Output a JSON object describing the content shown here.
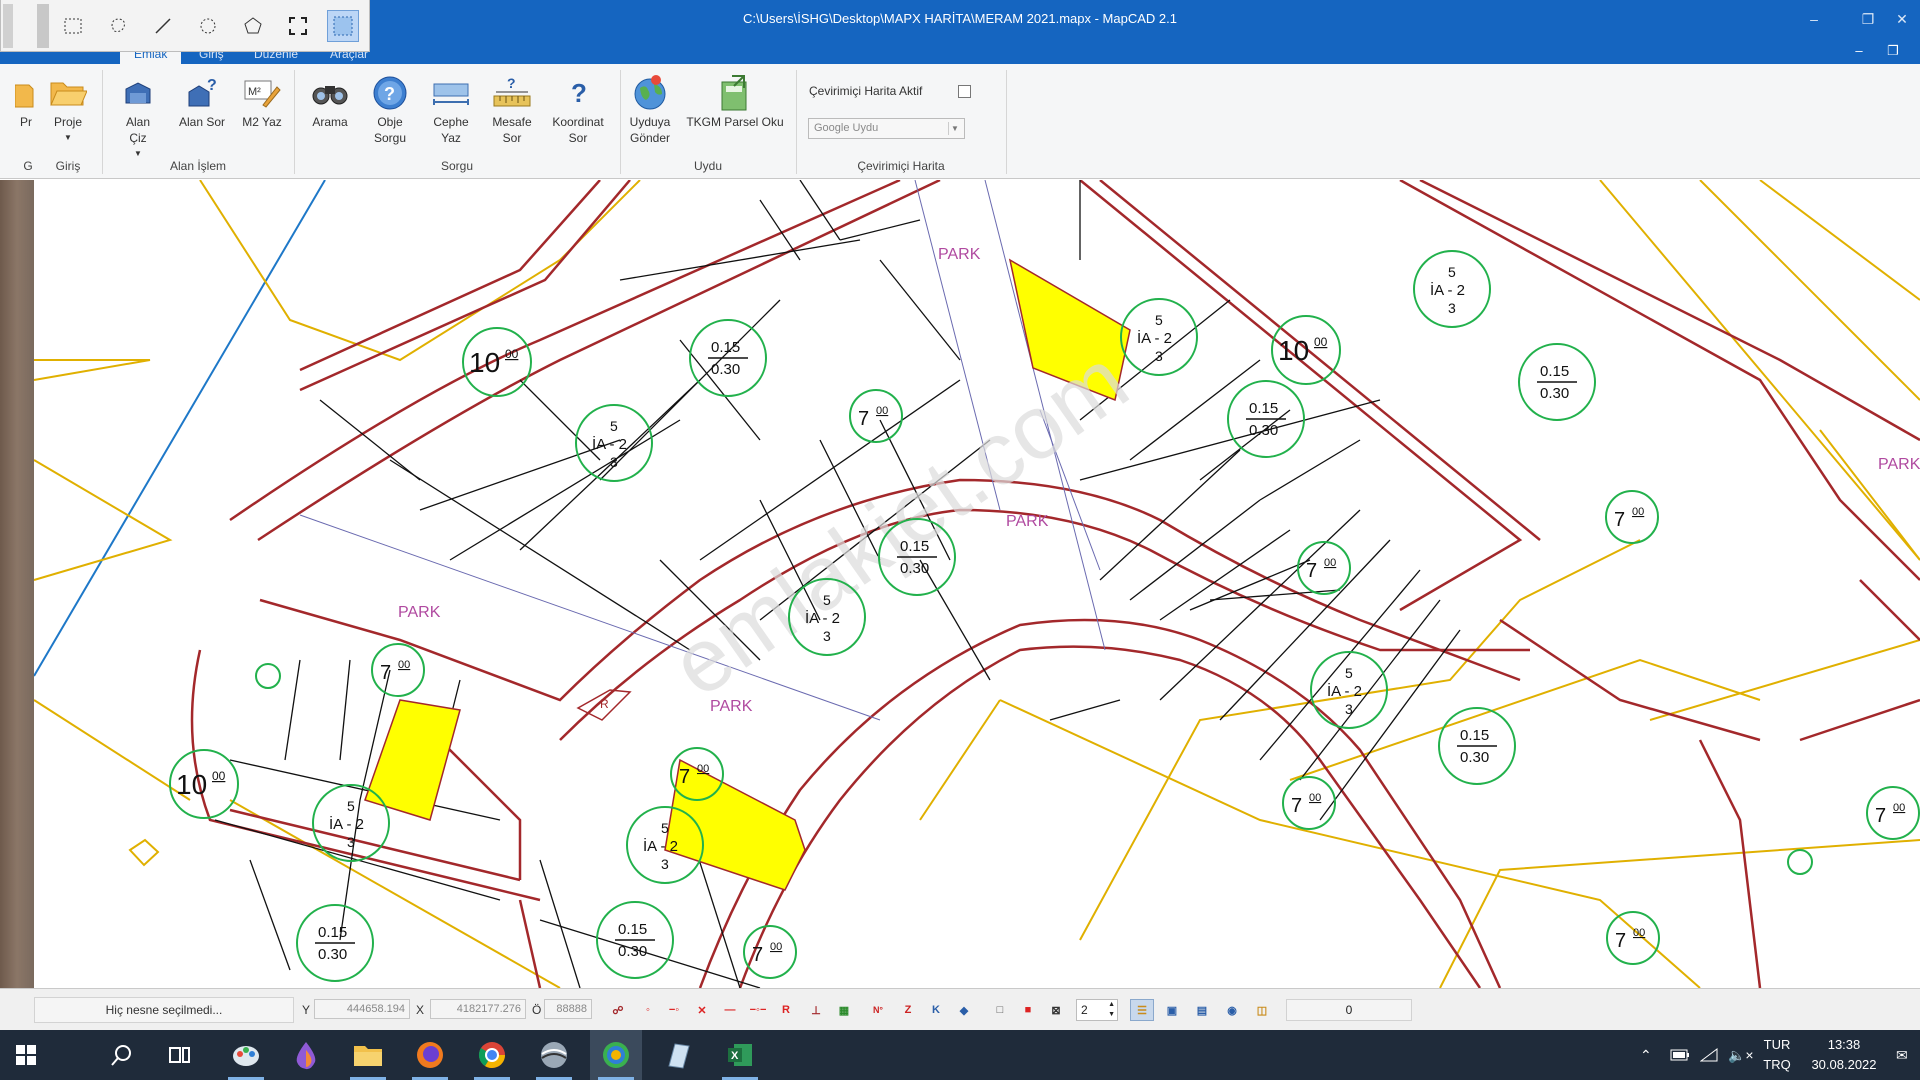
{
  "window": {
    "title": "C:\\Users\\İSHG\\Desktop\\MAPX HARİTA\\MERAM 2021.mapx - MapCAD 2.1",
    "tabs": [
      "Emlak",
      "Giriş",
      "Düzenle",
      "Araçlar"
    ]
  },
  "ribbon": {
    "buttons": [
      {
        "label": "Pr",
        "icon": "folder-icon"
      },
      {
        "label": "Proje",
        "icon": "folder-open-icon"
      },
      {
        "label": "Alan\nÇiz",
        "icon": "draw-area-icon"
      },
      {
        "label": "Alan Sor",
        "icon": "area-query-icon"
      },
      {
        "label": "M2 Yaz",
        "icon": "m2-write-icon"
      },
      {
        "label": "Arama",
        "icon": "binoculars-icon"
      },
      {
        "label": "Obje\nSorgu",
        "icon": "help-circle-icon"
      },
      {
        "label": "Cephe\nYaz",
        "icon": "facade-icon"
      },
      {
        "label": "Mesafe\nSor",
        "icon": "measure-icon"
      },
      {
        "label": "Koordinat\nSor",
        "icon": "question-icon"
      },
      {
        "label": "Uyduya\nGönder",
        "icon": "globe-icon"
      },
      {
        "label": "TKGM Parsel Oku",
        "icon": "parcel-read-icon"
      }
    ],
    "groups": [
      "G",
      "Giriş",
      "Alan İşlem",
      "Sorgu",
      "Uydu",
      "Çevirimiçi Harita"
    ],
    "online_map": {
      "checkbox_label": "Çevirimiçi Harita Aktif",
      "checked": false,
      "combo_value": "Google Uydu"
    }
  },
  "map": {
    "park_labels": [
      "PARK",
      "PARK",
      "PARK",
      "PARK",
      "PARK"
    ],
    "road_labels": {
      "ten": "10",
      "ten_sup": "00",
      "seven": "7",
      "seven_sup": "00"
    },
    "zoning": {
      "top": "5",
      "mid": "İA - 2",
      "bottom": "3"
    },
    "ratio": {
      "num": "0.15",
      "den": "0.30"
    },
    "watermark": "emlakjet.com",
    "point_label": "R",
    "colors": {
      "road_red": "#a3282b",
      "highlight_yellow": "#ffff00",
      "circle_green": "#22b14c",
      "outline_yellow": "#e0b000",
      "park_label": "#b04aa0",
      "blue_line": "#1e78c8"
    }
  },
  "status": {
    "message": "Hiç nesne seçilmedi...",
    "y_label": "Y",
    "y_value": "444658.194",
    "x_label": "X",
    "x_value": "4182177.276",
    "o_label": "Ö",
    "o_value": "88888",
    "spin_value": "2",
    "count": "0"
  },
  "taskbar": {
    "lang_top": "TUR",
    "lang_bottom": "TRQ",
    "time": "13:38",
    "date": "30.08.2022"
  }
}
